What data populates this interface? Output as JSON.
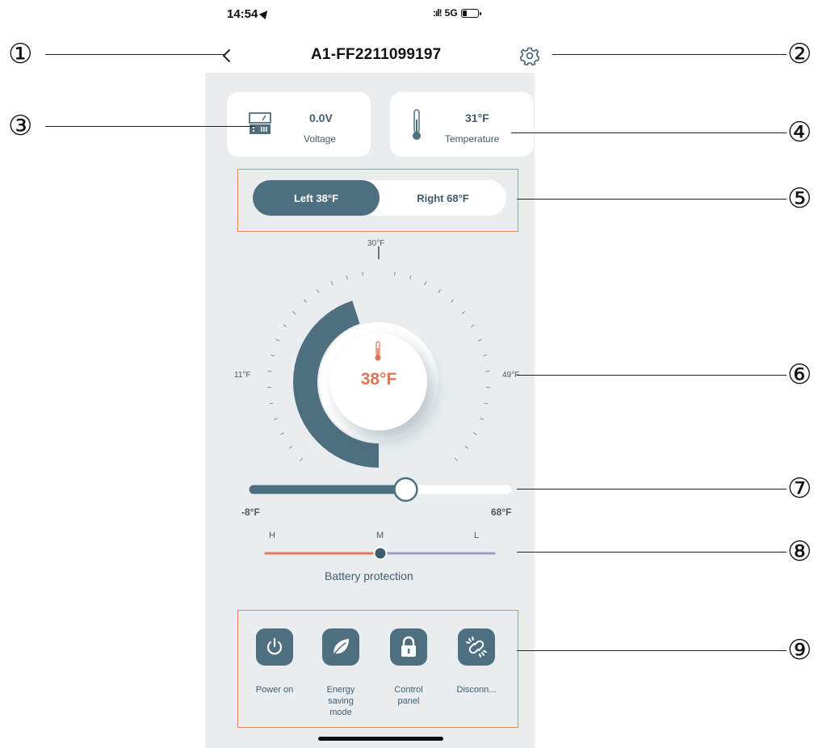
{
  "status_bar": {
    "time": "14:54",
    "network": "5G"
  },
  "nav": {
    "title": "A1-FF2211099197",
    "back_icon": "chevron-left-icon",
    "settings_icon": "gear-icon"
  },
  "stats": {
    "voltage": {
      "value": "0.0V",
      "label": "Voltage",
      "icon": "battery-meter-icon"
    },
    "temperature": {
      "value": "31°F",
      "label": "Temperature",
      "icon": "thermometer-icon"
    }
  },
  "zones": {
    "left_label": "Left 38°F",
    "right_label": "Right 68°F",
    "selected": "left"
  },
  "dial": {
    "value": "38°F",
    "top_label": "30°F",
    "left_label": "11°F",
    "right_label": "49°F",
    "fill_fraction": 0.45
  },
  "slider": {
    "min_label": "-8°F",
    "max_label": "68°F",
    "fraction": 0.6
  },
  "battery_protection": {
    "title": "Battery protection",
    "levels": [
      "H",
      "M",
      "L"
    ],
    "selected": "M"
  },
  "controls": [
    {
      "label": "Power on",
      "icon": "power-icon"
    },
    {
      "label": "Energy saving mode",
      "icon": "leaf-icon"
    },
    {
      "label": "Control panel",
      "icon": "lock-icon"
    },
    {
      "label": "Disconn...",
      "icon": "broken-link-icon"
    }
  ],
  "callouts": [
    "①",
    "②",
    "③",
    "④",
    "⑤",
    "⑥",
    "⑦",
    "⑧",
    "⑨"
  ],
  "colors": {
    "accent": "#4e6f80",
    "temperature": "#df7556",
    "high": "#e47b5e",
    "low": "#9d9ac3",
    "highlight_border": "#e8875d",
    "background": "#e9edef"
  }
}
